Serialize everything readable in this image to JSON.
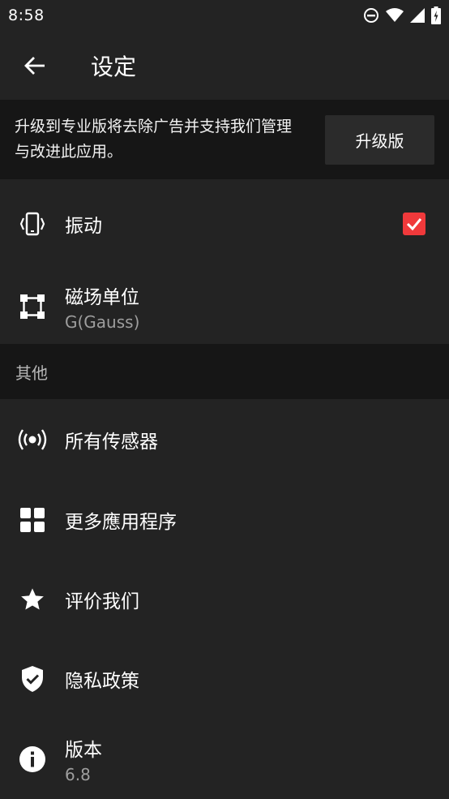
{
  "status_bar": {
    "time": "8:58"
  },
  "app_bar": {
    "title": "设定"
  },
  "banner": {
    "text": "升级到专业版将去除广告并支持我们管理与改进此应用。",
    "button_label": "升级版"
  },
  "settings": {
    "vibration": {
      "label": "振动",
      "checked": true,
      "icon": "vibration-icon"
    },
    "magnetic_unit": {
      "label": "磁场单位",
      "value": "G(Gauss)",
      "icon": "unit-icon"
    }
  },
  "section_other": {
    "header": "其他"
  },
  "other_items": {
    "all_sensors": {
      "label": "所有传感器",
      "icon": "sensor-icon"
    },
    "more_apps": {
      "label": "更多應用程序",
      "icon": "apps-grid-icon"
    },
    "rate_us": {
      "label": "评价我们",
      "icon": "star-icon"
    },
    "privacy": {
      "label": "隐私政策",
      "icon": "shield-icon"
    },
    "version": {
      "label": "版本",
      "value": "6.8",
      "icon": "info-icon"
    }
  },
  "colors": {
    "background": "#232323",
    "banner": "#161616",
    "accent": "#f0393b",
    "secondary_text": "#9e9e9e"
  }
}
